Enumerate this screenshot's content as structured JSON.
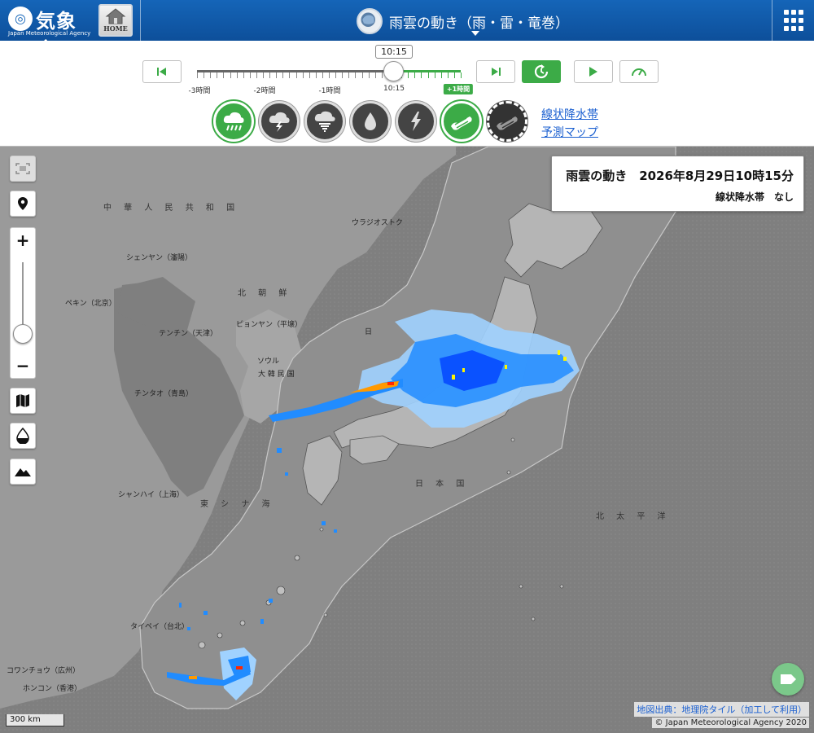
{
  "header": {
    "logo_jp": "気象庁",
    "logo_en": "Japan Meteorological Agency",
    "home_label": "HOME",
    "title": "雨雲の動き（雨・雷・竜巻）"
  },
  "timeline": {
    "current_time": "10:15",
    "tick_labels": [
      "-3時間",
      "-2時間",
      "-1時間",
      "10:15",
      "+1時間"
    ],
    "position_fraction": 0.75
  },
  "layers": {
    "items": [
      "rain-cloud-icon",
      "thunder-cloud-icon",
      "tornado-cloud-icon",
      "rain-drop-icon",
      "lightning-icon",
      "linear-rainband-icon",
      "forecast-rainband-icon"
    ],
    "active": [
      "rain-cloud-icon",
      "linear-rainband-icon"
    ]
  },
  "links": {
    "linear_rainband": "線状降水帯",
    "forecast_map": "予測マップ"
  },
  "info": {
    "title": "雨雲の動き　2026年8月29日10時15分",
    "status": "線状降水帯　なし"
  },
  "map_labels": {
    "china": "中 華 人 民 共 和 国",
    "vladivostok": "ウラジオストク",
    "shenyang": "シェンヤン（瀋陽）",
    "north_korea": "北 朝 鮮",
    "beijing": "ペキン（北京）",
    "tianjin": "テンチン（天津）",
    "pyongyang": "ピョンヤン（平壌）",
    "seoul": "ソウル",
    "south_korea": "大 韓 民 国",
    "qingdao": "チンタオ（青島）",
    "shanghai": "シャンハイ（上海）",
    "east_china_sea": "東 シ ナ 海",
    "sea_of_japan": "日 本 海",
    "japan": "日 本 国",
    "pacific": "北 太 平 洋",
    "taipei": "タイペイ（台北）",
    "guangzhou": "コワンチョウ（広州）",
    "hongkong": "ホンコン（香港）",
    "sea_of_japan_short": "日"
  },
  "scale": "300 km",
  "attribution": {
    "line1": "地図出典：地理院タイル（加工して利用）",
    "line2": "© Japan Meteorological Agency 2020"
  },
  "colors": {
    "header_blue": "#1565b8",
    "accent_green": "#3cab47",
    "rain_light": "#a0d2ff",
    "rain_mid": "#218cff",
    "rain_strong": "#0041ff",
    "rain_yellow": "#fff500",
    "rain_orange": "#ff9900",
    "rain_red": "#ff2800"
  }
}
